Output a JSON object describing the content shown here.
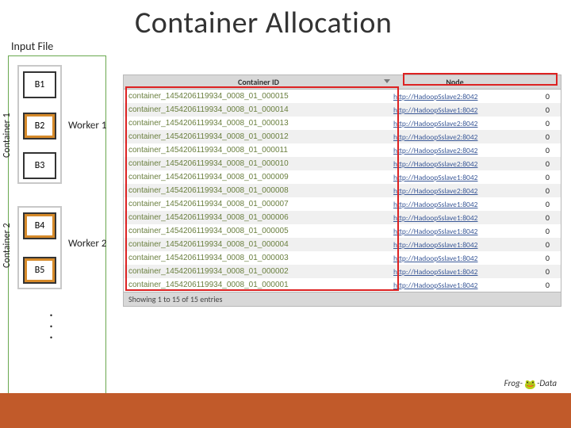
{
  "title": "Container Allocation",
  "input_file_label": "Input File",
  "container_labels": {
    "c1": "Container 1",
    "c2": "Container 2"
  },
  "blocks": {
    "b1": "B1",
    "b2": "B2",
    "b3": "B3",
    "b4": "B4",
    "b5": "B5"
  },
  "workers": {
    "w1": "Worker 1",
    "w2": "Worker 2"
  },
  "table": {
    "headers": {
      "id": "Container ID",
      "node": "Node",
      "num": ""
    },
    "footer": "Showing 1 to 15 of 15 entries",
    "rows": [
      {
        "id": "container_1454206119934_0008_01_000015",
        "node": "http://HadoopSslave2:8042",
        "num": "0"
      },
      {
        "id": "container_1454206119934_0008_01_000014",
        "node": "http://HadoopSslave1:8042",
        "num": "0"
      },
      {
        "id": "container_1454206119934_0008_01_000013",
        "node": "http://HadoopSslave2:8042",
        "num": "0"
      },
      {
        "id": "container_1454206119934_0008_01_000012",
        "node": "http://HadoopSslave2:8042",
        "num": "0"
      },
      {
        "id": "container_1454206119934_0008_01_000011",
        "node": "http://HadoopSslave2:8042",
        "num": "0"
      },
      {
        "id": "container_1454206119934_0008_01_000010",
        "node": "http://HadoopSslave2:8042",
        "num": "0"
      },
      {
        "id": "container_1454206119934_0008_01_000009",
        "node": "http://HadoopSslave1:8042",
        "num": "0"
      },
      {
        "id": "container_1454206119934_0008_01_000008",
        "node": "http://HadoopSslave2:8042",
        "num": "0"
      },
      {
        "id": "container_1454206119934_0008_01_000007",
        "node": "http://HadoopSslave1:8042",
        "num": "0"
      },
      {
        "id": "container_1454206119934_0008_01_000006",
        "node": "http://HadoopSslave1:8042",
        "num": "0"
      },
      {
        "id": "container_1454206119934_0008_01_000005",
        "node": "http://HadoopSslave1:8042",
        "num": "0"
      },
      {
        "id": "container_1454206119934_0008_01_000004",
        "node": "http://HadoopSslave1:8042",
        "num": "0"
      },
      {
        "id": "container_1454206119934_0008_01_000003",
        "node": "http://HadoopSslave1:8042",
        "num": "0"
      },
      {
        "id": "container_1454206119934_0008_01_000002",
        "node": "http://HadoopSslave1:8042",
        "num": "0"
      },
      {
        "id": "container_1454206119934_0008_01_000001",
        "node": "http://HadoopSslave1:8042",
        "num": "0"
      }
    ]
  },
  "logo": {
    "prefix": "Frog-",
    "suffix": "-Data"
  }
}
